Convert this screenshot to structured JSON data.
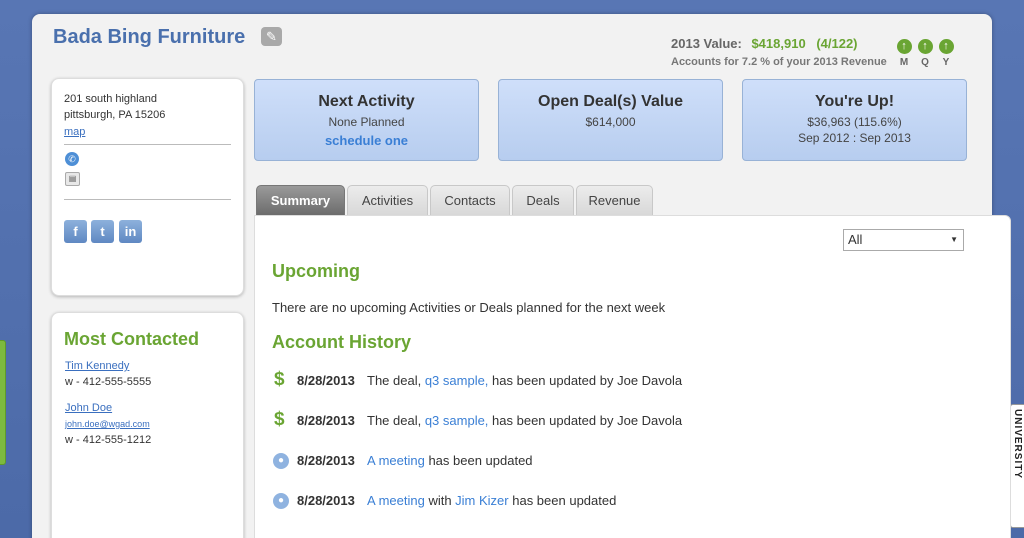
{
  "header": {
    "company": "Bada Bing Furniture",
    "value_label": "2013 Value:",
    "value_amount": "$418,910",
    "value_count": "(4/122)",
    "value_sub": "Accounts for 7.2 % of your 2013 Revenue",
    "periods": [
      {
        "label": "M",
        "icon": "up-arrow-icon"
      },
      {
        "label": "Q",
        "icon": "up-arrow-icon"
      },
      {
        "label": "Y",
        "icon": "up-arrow-icon"
      }
    ]
  },
  "address": {
    "line1": "201 south highland",
    "line2": "pittsburgh, PA 15206",
    "map_link": "map"
  },
  "most_contacted": {
    "title": "Most Contacted",
    "contacts": [
      {
        "name": "Tim Kennedy",
        "phone": "w - 412-555-5555"
      },
      {
        "name": "John Doe",
        "email": "john.doe@wgad.com",
        "phone": "w - 412-555-1212"
      }
    ]
  },
  "stats": [
    {
      "title": "Next Activity",
      "line1": "None Planned",
      "link": "schedule one"
    },
    {
      "title": "Open Deal(s) Value",
      "line1": "$614,000"
    },
    {
      "title": "You're Up!",
      "line1": "$36,963 (115.6%)",
      "line2": "Sep 2012 : Sep 2013"
    }
  ],
  "tabs": [
    "Summary",
    "Activities",
    "Contacts",
    "Deals",
    "Revenue"
  ],
  "active_tab": "Summary",
  "filter": {
    "selected": "All"
  },
  "upcoming": {
    "title": "Upcoming",
    "text": "There are no upcoming Activities or Deals planned for the next week"
  },
  "history": {
    "title": "Account History",
    "rows": [
      {
        "icon": "dollar-icon",
        "date": "8/28/2013",
        "pre": "The deal, ",
        "link": "q3 sample,",
        "post": " has been updated by Joe Davola"
      },
      {
        "icon": "dollar-icon",
        "date": "8/28/2013",
        "pre": "The deal, ",
        "link": "q3 sample,",
        "post": " has been updated by Joe Davola"
      },
      {
        "icon": "person-icon",
        "date": "8/28/2013",
        "pre": "",
        "link": "A meeting",
        "post": " has been updated"
      },
      {
        "icon": "person-icon",
        "date": "8/28/2013",
        "pre": "",
        "link": "A meeting",
        "mid": " with ",
        "link2": "Jim Kizer",
        "post": " has been updated"
      }
    ]
  },
  "side_tab": "UNIVERSITY",
  "colors": {
    "accent_green": "#6aa533",
    "accent_blue": "#4a70ad",
    "link_blue": "#3a7fd5"
  }
}
